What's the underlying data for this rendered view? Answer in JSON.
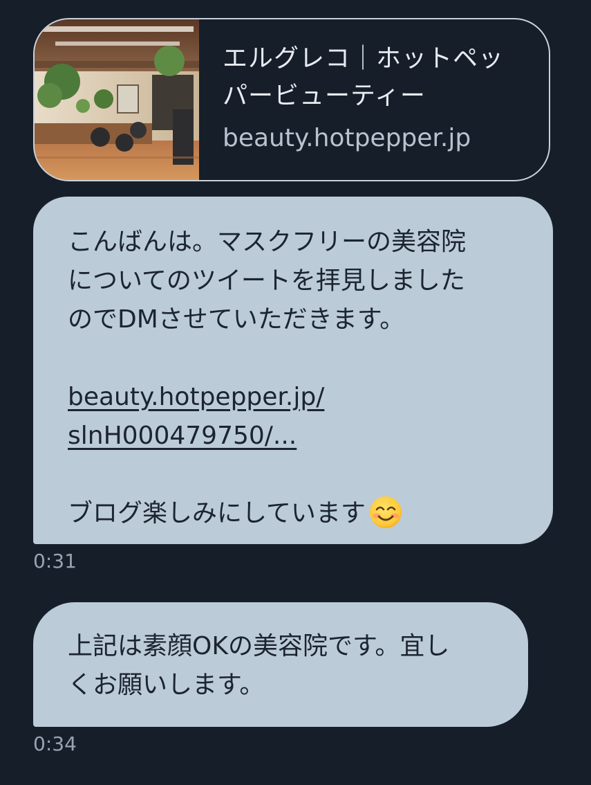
{
  "link_preview": {
    "title_line1": "エルグレコ｜ホットペッ",
    "title_line2": "パービューティー",
    "domain": "beauty.hotpepper.jp",
    "thumbnail": "salon-interior-photo"
  },
  "messages": [
    {
      "lines": [
        "こんばんは。マスクフリーの美容院",
        "についてのツイートを拝見しました",
        "のでDMさせていただきます。"
      ],
      "link_line1": "beauty.hotpepper.jp/",
      "link_line2": "slnH000479750/...",
      "closing": "ブログ楽しみにしています",
      "emoji": "smiling-face-emoji",
      "time": "0:31"
    },
    {
      "lines": [
        "上記は素顔OKの美容院です。宜し",
        "くお願いします。"
      ],
      "time": "0:34"
    }
  ],
  "colors": {
    "background": "#161e2a",
    "bubble": "#bccbd8",
    "card_border": "#c9d2dc"
  }
}
